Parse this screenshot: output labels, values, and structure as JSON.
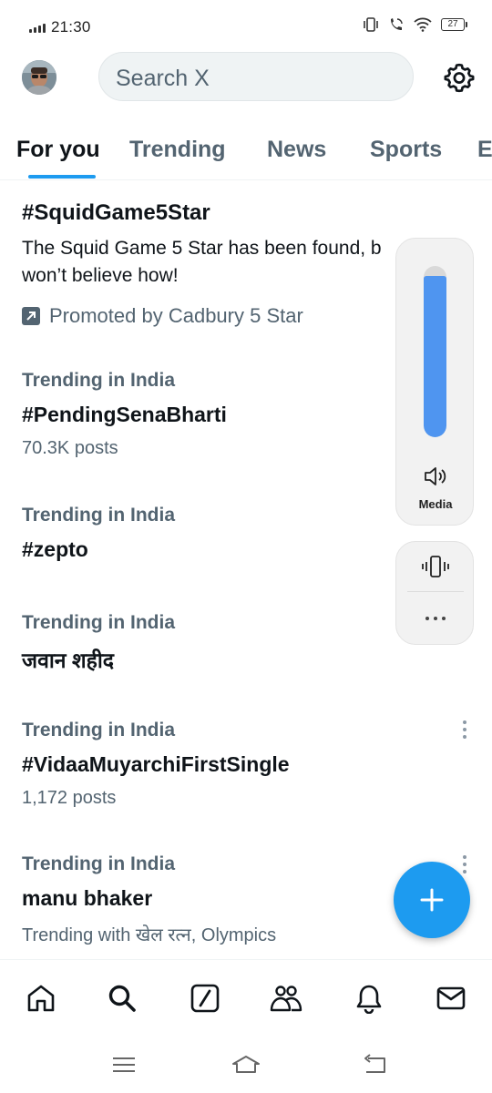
{
  "status_bar": {
    "time": "21:30",
    "battery": "27"
  },
  "header": {
    "search_placeholder": "Search X"
  },
  "tabs": [
    {
      "label": "For you",
      "active": true
    },
    {
      "label": "Trending",
      "active": false
    },
    {
      "label": "News",
      "active": false
    },
    {
      "label": "Sports",
      "active": false
    },
    {
      "label": "E",
      "active": false
    }
  ],
  "promoted": {
    "title": "#SquidGame5Star",
    "line1": "The Squid Game 5 Star has been found, b",
    "line2": "won’t believe how!",
    "label": "Promoted by Cadbury 5 Star"
  },
  "trends": [
    {
      "meta": "Trending in India",
      "topic": "#PendingSenaBharti",
      "count": "70.3K posts"
    },
    {
      "meta": "Trending in India",
      "topic": "#zepto"
    },
    {
      "meta": "Trending in India",
      "topic": "जवान शहीद"
    },
    {
      "meta": "Trending in India",
      "topic": "#VidaaMuyarchiFirstSingle",
      "count": "1,172 posts"
    },
    {
      "meta": "Trending in India",
      "topic": "manu bhaker",
      "count": "Trending with खेल रत्न, Olympics"
    }
  ],
  "volume_overlay": {
    "label": "Media",
    "level": 0.94
  },
  "colors": {
    "accent": "#1d9bf0",
    "secondary_text": "#536471",
    "volume_fill": "#4f95f0"
  },
  "icons": {
    "bottom_nav": [
      "home-icon",
      "search-icon",
      "grok-icon",
      "communities-icon",
      "notifications-icon",
      "messages-icon"
    ],
    "fab": "plus-icon",
    "header": "settings-gear-icon"
  }
}
